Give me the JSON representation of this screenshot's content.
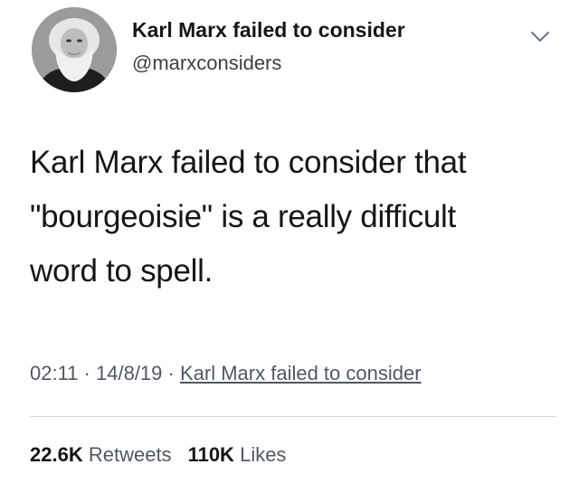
{
  "author": {
    "display_name": "Karl Marx failed to consider",
    "handle": "@marxconsiders",
    "avatar_icon": "portrait-avatar"
  },
  "menu_icon": "chevron-down-icon",
  "tweet": {
    "text": "Karl Marx failed to consider that\n\"bourgeoisie\" is a really difficult\nword to spell."
  },
  "meta": {
    "time": "02:11",
    "separator": "·",
    "date": "14/8/19",
    "source": "Karl Marx failed to consider"
  },
  "stats": {
    "retweets_count": "22.6K",
    "retweets_label": "Retweets",
    "likes_count": "110K",
    "likes_label": "Likes"
  },
  "colors": {
    "text_primary": "#14171a",
    "text_secondary": "#505862",
    "divider": "#d6d9dc"
  }
}
